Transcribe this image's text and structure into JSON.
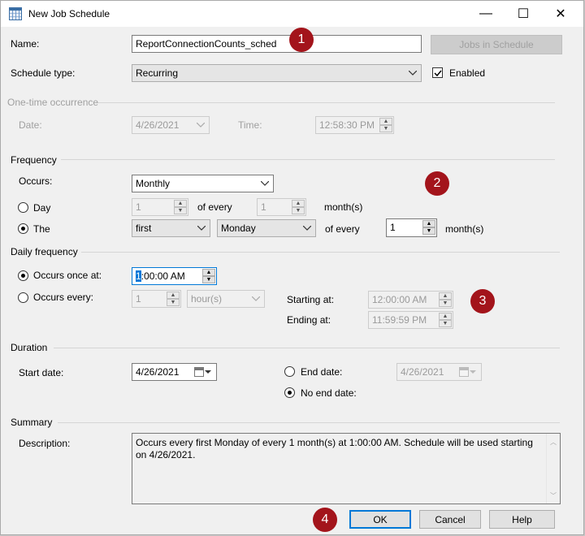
{
  "window": {
    "title": "New Job Schedule",
    "minimize": "—",
    "maximize": "☐",
    "close": "✕"
  },
  "name": {
    "label": "Name:",
    "value": "ReportConnectionCounts_sched",
    "jobs_button": "Jobs in Schedule"
  },
  "schedule_type": {
    "label": "Schedule type:",
    "value": "Recurring",
    "enabled_label": "Enabled",
    "enabled": true
  },
  "one_time": {
    "group": "One-time occurrence",
    "date_label": "Date:",
    "date_value": "4/26/2021",
    "time_label": "Time:",
    "time_value": "12:58:30 PM"
  },
  "frequency": {
    "group": "Frequency",
    "occurs_label": "Occurs:",
    "occurs_value": "Monthly",
    "day_label": "Day",
    "day_value": "1",
    "of_every_1": "of every",
    "day_months": "1",
    "months_1": "month(s)",
    "the_label": "The",
    "the_ordinal": "first",
    "the_weekday": "Monday",
    "of_every_2": "of every",
    "the_months": "1",
    "months_2": "month(s)",
    "selected": "The"
  },
  "daily": {
    "group": "Daily frequency",
    "once_label": "Occurs once at:",
    "once_value_hour": "1",
    "once_value_rest": ":00:00 AM",
    "every_label": "Occurs every:",
    "every_value": "1",
    "every_unit": "hour(s)",
    "starting_label": "Starting at:",
    "starting_value": "12:00:00 AM",
    "ending_label": "Ending at:",
    "ending_value": "11:59:59 PM",
    "selected": "Occurs once at:"
  },
  "duration": {
    "group": "Duration",
    "start_label": "Start date:",
    "start_value": "4/26/2021",
    "end_label": "End date:",
    "end_value": "4/26/2021",
    "no_end_label": "No end date:",
    "selected": "No end date:"
  },
  "summary": {
    "group": "Summary",
    "desc_label": "Description:",
    "description": "Occurs every first Monday of every 1 month(s) at 1:00:00 AM. Schedule will be used starting on 4/26/2021."
  },
  "buttons": {
    "ok": "OK",
    "cancel": "Cancel",
    "help": "Help"
  },
  "badges": [
    "1",
    "2",
    "3",
    "4"
  ],
  "colors": {
    "badge": "#a3141b",
    "accent": "#0078d7"
  }
}
